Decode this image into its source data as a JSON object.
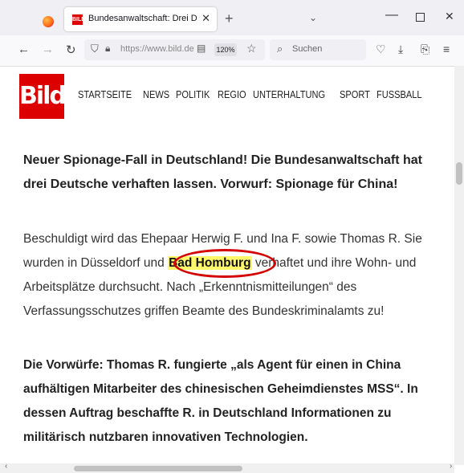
{
  "browser": {
    "tab_title": "Bundesanwaltschaft: Drei Deutsche ...",
    "tab_favicon_text": "BILD",
    "url": "https://www.bild.de",
    "zoom": "120%",
    "search_placeholder": "Suchen"
  },
  "site": {
    "logo": "Bild",
    "nav": [
      "STARTSEITE",
      "NEWS",
      "POLITIK",
      "REGIO",
      "UNTERHALTUNG",
      "SPORT",
      "FUSSBALL"
    ]
  },
  "article": {
    "lead": "Neuer Spionage-Fall in Deutschland! Die Bundesanwaltschaft hat drei Deutsche verhaften lassen. Vorwurf: Spionage für China!",
    "body_part1": "Beschuldigt wird das Ehepaar Herwig F. und Ina F. sowie Thomas R. Sie wurden in Düsseldorf und ",
    "body_highlight": "Bad Homburg",
    "body_part2": " verhaftet und ihre Wohn- und Arbeitsplätze durchsucht. Nach „Erkenntnismitteilungen“ des Verfassungsschutzes griffen Beamte des Bundeskriminalamts zu!",
    "bold_paragraph": "Die Vorwürfe: Thomas R. fungierte „als Agent für einen in China aufhältigen Mitarbeiter des chinesischen Geheimdienstes MSS“. In dessen Auftrag beschaffte R. in Deutschland Informationen zu militärisch nutzbaren innovativen Technologien."
  },
  "colors": {
    "brand": "#dd0000",
    "highlight": "#fff86b",
    "circle": "#d40000"
  }
}
